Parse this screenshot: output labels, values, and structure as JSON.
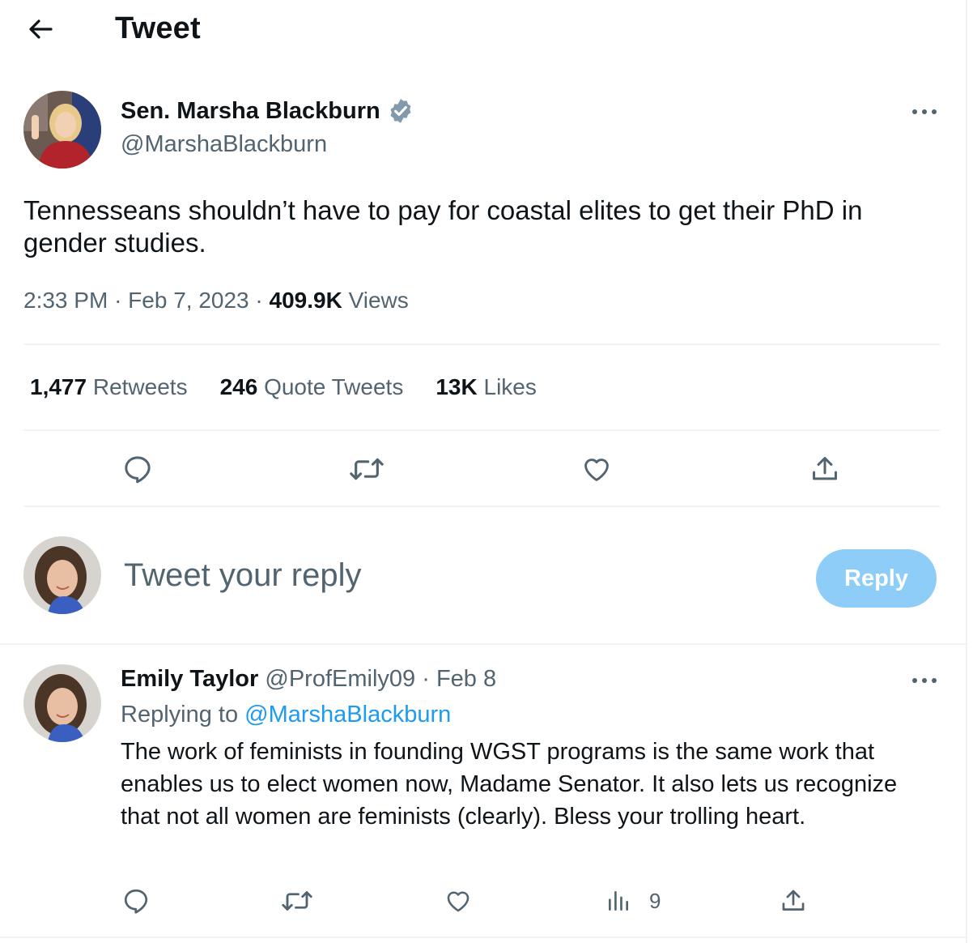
{
  "header": {
    "title": "Tweet"
  },
  "tweet": {
    "author_name": "Sen. Marsha Blackburn",
    "author_handle": "@MarshaBlackburn",
    "text": "Tennesseans shouldn’t have to pay for coastal elites to get their PhD in gender studies.",
    "time": "2:33 PM",
    "date": "Feb 7, 2023",
    "views_count": "409.9K",
    "views_label": "Views",
    "retweets_count": "1,477",
    "retweets_label": "Retweets",
    "quotes_count": "246",
    "quotes_label": "Quote Tweets",
    "likes_count": "13K",
    "likes_label": "Likes"
  },
  "composer": {
    "placeholder": "Tweet your reply",
    "button_label": "Reply"
  },
  "reply": {
    "author_name": "Emily Taylor",
    "author_handle": "@ProfEmily09",
    "date": "Feb 8",
    "replying_prefix": "Replying to",
    "replying_mention": "@MarshaBlackburn",
    "text": "The work of feminists in founding WGST programs is the same work that enables us to elect women now, Madame Senator. It also lets us recognize that not all women are feminists (clearly). Bless your trolling heart.",
    "views_count": "9"
  },
  "colors": {
    "text_primary": "#0f1419",
    "text_secondary": "#536471",
    "accent": "#1d9bf0",
    "reply_button_disabled": "#8ecdf8",
    "divider": "#eff3f4"
  },
  "icons": [
    "back-arrow-icon",
    "verified-badge-icon",
    "more-icon",
    "reply-icon",
    "retweet-icon",
    "like-icon",
    "share-icon",
    "views-icon"
  ]
}
